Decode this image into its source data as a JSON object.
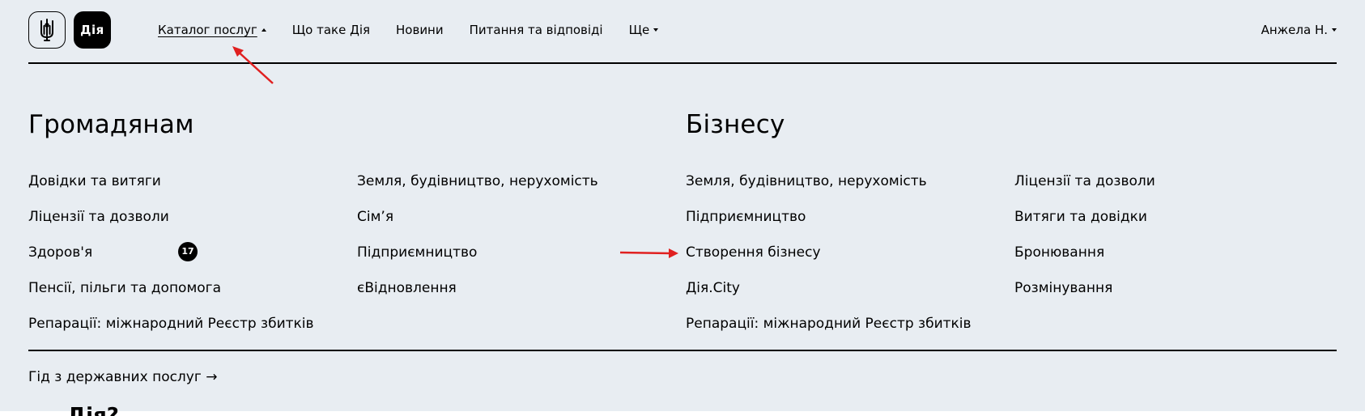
{
  "header": {
    "logo_trident_icon": "trident-icon",
    "logo_diia": "Дія",
    "nav": [
      {
        "label": "Каталог послуг",
        "caret": "up",
        "active": true
      },
      {
        "label": "Що таке Дія",
        "caret": "",
        "active": false
      },
      {
        "label": "Новини",
        "caret": "",
        "active": false
      },
      {
        "label": "Питання та відповіді",
        "caret": "",
        "active": false
      },
      {
        "label": "Ще",
        "caret": "down",
        "active": false
      }
    ],
    "user": "Анжела Н."
  },
  "citizens": {
    "title": "Громадянам",
    "col1": [
      "Довідки та витяги",
      "Ліцензії та дозволи",
      "Здоров'я",
      "Пенсії, пільги та допомога",
      "Репарації: міжнародний Реєстр збитків"
    ],
    "col2": [
      "Земля, будівництво, нерухомість",
      "Сім’я",
      "Підприємництво",
      "єВідновлення"
    ],
    "health_badge": "17"
  },
  "business": {
    "title": "Бізнесу",
    "col1": [
      "Земля, будівництво, нерухомість",
      "Підприємництво",
      "Створення бізнесу",
      "Дія.City",
      "Репарації: міжнародний Реєстр збитків"
    ],
    "col2": [
      "Ліцензії та дозволи",
      "Витяги та довідки",
      "Бронювання",
      "Розмінування"
    ]
  },
  "footer": {
    "guide": "Гід з державних послуг →"
  },
  "below": {
    "cutoff": "Дія?"
  },
  "colors": {
    "panel_bg": "#e8edf2",
    "annotation": "#e02020"
  }
}
